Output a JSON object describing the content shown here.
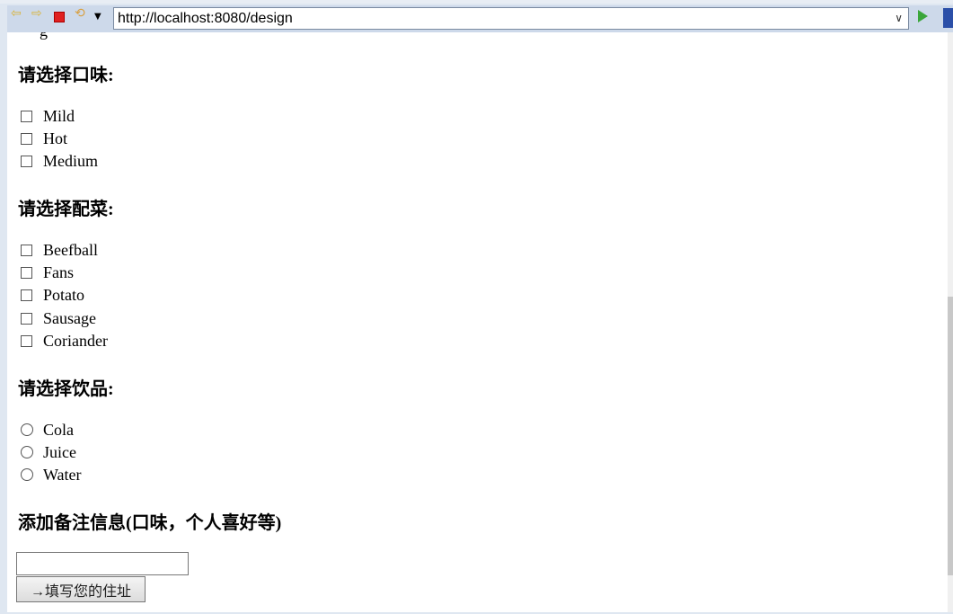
{
  "browser": {
    "url": "http://localhost:8080/design",
    "icons": [
      "back-icon",
      "forward-icon",
      "stop-icon",
      "refresh-icon",
      "dropdown-icon",
      "go-icon"
    ]
  },
  "form": {
    "cut_text": "g",
    "flavor": {
      "title": "请选择口味:",
      "options": [
        "Mild",
        "Hot",
        "Medium"
      ]
    },
    "sides": {
      "title": "请选择配菜:",
      "options": [
        "Beefball",
        "Fans",
        "Potato",
        "Sausage",
        "Coriander"
      ]
    },
    "drinks": {
      "title": "请选择饮品:",
      "options": [
        "Cola",
        "Juice",
        "Water"
      ]
    },
    "notes": {
      "title": "添加备注信息(口味，个人喜好等)",
      "value": ""
    },
    "submit_label": "→填写您的住址"
  }
}
